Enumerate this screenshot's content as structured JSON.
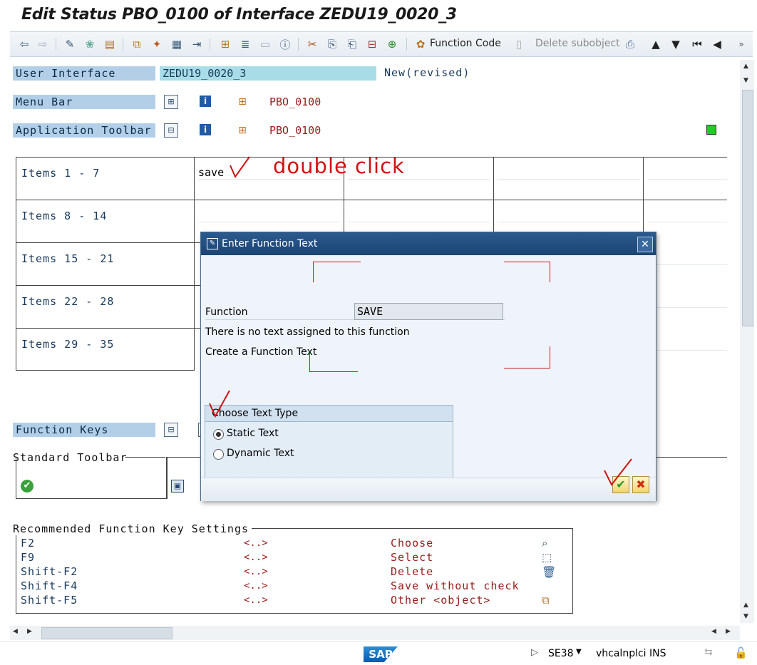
{
  "window": {
    "title": "Edit Status PBO_0100 of Interface ZEDU19_0020_3"
  },
  "toolbar": {
    "function_code_label": "Function Code",
    "delete_subobject_label": "Delete subobject"
  },
  "user_interface": {
    "label": "User Interface",
    "value": "ZEDU19_0020_3",
    "status": "New(revised)"
  },
  "menu_bar": {
    "label": "Menu Bar",
    "value": "PBO_0100"
  },
  "application_toolbar": {
    "label": "Application Toolbar",
    "value": "PBO_0100"
  },
  "items_rows": [
    {
      "label": "Items  1 -  7",
      "first_value": "save"
    },
    {
      "label": "Items  8 - 14",
      "first_value": ""
    },
    {
      "label": "Items 15 - 21",
      "first_value": ""
    },
    {
      "label": "Items 22 - 28",
      "first_value": ""
    },
    {
      "label": "Items 29 - 35",
      "first_value": ""
    }
  ],
  "annotation": {
    "double_click": "double click"
  },
  "function_keys": {
    "label": "Function Keys"
  },
  "standard_toolbar": {
    "label": "Standard Toolbar"
  },
  "recommended": {
    "label": "Recommended Function Key Settings",
    "rows": [
      {
        "key": "F2",
        "code": "<..>",
        "text": "Choose"
      },
      {
        "key": "F9",
        "code": "<..>",
        "text": "Select"
      },
      {
        "key": "Shift-F2",
        "code": "<..>",
        "text": "Delete"
      },
      {
        "key": "Shift-F4",
        "code": "<..>",
        "text": "Save without check"
      },
      {
        "key": "Shift-F5",
        "code": "<..>",
        "text": "Other <object>"
      }
    ]
  },
  "dialog": {
    "title": "Enter Function Text",
    "function_label": "Function",
    "function_value": "SAVE",
    "no_text_msg": "There is no text assigned to this function",
    "create_msg": "Create a Function Text",
    "group_title": "Choose Text Type",
    "options": [
      "Static Text",
      "Dynamic Text"
    ],
    "selected_option": "Static Text"
  },
  "statusbar": {
    "logo": "SAP",
    "transaction": "SE38",
    "host": "vhcalnplci",
    "mode": "INS"
  },
  "colors": {
    "accent": "#b3cfe8",
    "dialog_header": "#1c4474",
    "annotation_red": "#d31010"
  }
}
